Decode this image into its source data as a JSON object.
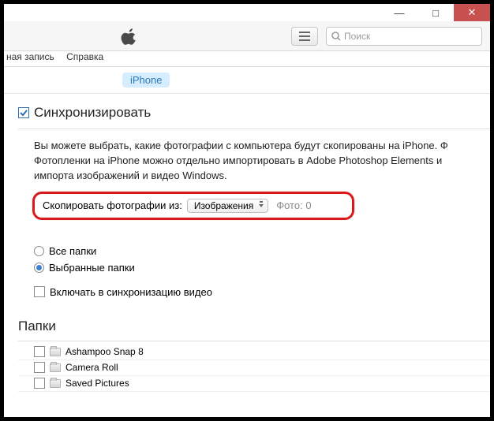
{
  "window": {
    "min": "—",
    "max": "□",
    "close": "✕"
  },
  "search": {
    "placeholder": "Поиск"
  },
  "menu": {
    "account": "ная запись",
    "help": "Справка"
  },
  "tabs": {
    "device": "iPhone"
  },
  "sync": {
    "title": "Синхронизировать",
    "desc_line1": "Вы можете выбрать, какие фотографии с компьютера будут скопированы на iPhone. Ф",
    "desc_line2": "Фотопленки на iPhone можно отдельно импортировать в Adobe Photoshop Elements и",
    "desc_line3": "импорта изображений и видео Windows.",
    "copy_label": "Скопировать фотографии из:",
    "copy_source": "Изображения",
    "photo_count": "Фото: 0",
    "radio_all": "Все папки",
    "radio_selected": "Выбранные папки",
    "include_video": "Включать в синхронизацию видео"
  },
  "folders": {
    "title": "Папки",
    "items": [
      {
        "name": "Ashampoo Snap 8"
      },
      {
        "name": "Camera Roll"
      },
      {
        "name": "Saved Pictures"
      }
    ]
  }
}
